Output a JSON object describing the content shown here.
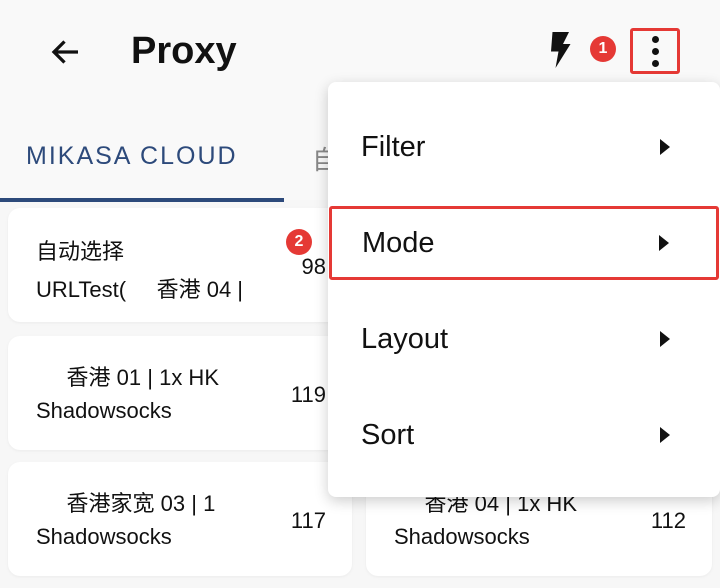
{
  "header": {
    "title": "Proxy",
    "back_icon": "arrow-left-icon",
    "action_icon": "lightning-bolt-icon",
    "more_icon": "more-vertical-icon"
  },
  "annotations": {
    "step1": "1",
    "step2": "2",
    "highlight_color": "#e53935"
  },
  "tabs": [
    {
      "label": "MIKASA CLOUD",
      "active": true
    },
    {
      "label": "自"
    }
  ],
  "accent_color": "#2d4a7b",
  "proxies": [
    {
      "name": "自动选择",
      "type": "URLTest(     香港 04 |",
      "latency": "98"
    },
    {
      "name": "     香港 01 | 1x HK",
      "type": "Shadowsocks",
      "latency": "119"
    },
    {
      "name": "     香港家宽 03 | 1",
      "type": "Shadowsocks",
      "latency": "117"
    },
    {
      "name": "     香港 04 | 1x HK",
      "type": "Shadowsocks",
      "latency": "112"
    }
  ],
  "menu": {
    "items": [
      {
        "label": "Filter"
      },
      {
        "label": "Mode",
        "highlighted": true
      },
      {
        "label": "Layout"
      },
      {
        "label": "Sort"
      }
    ]
  }
}
